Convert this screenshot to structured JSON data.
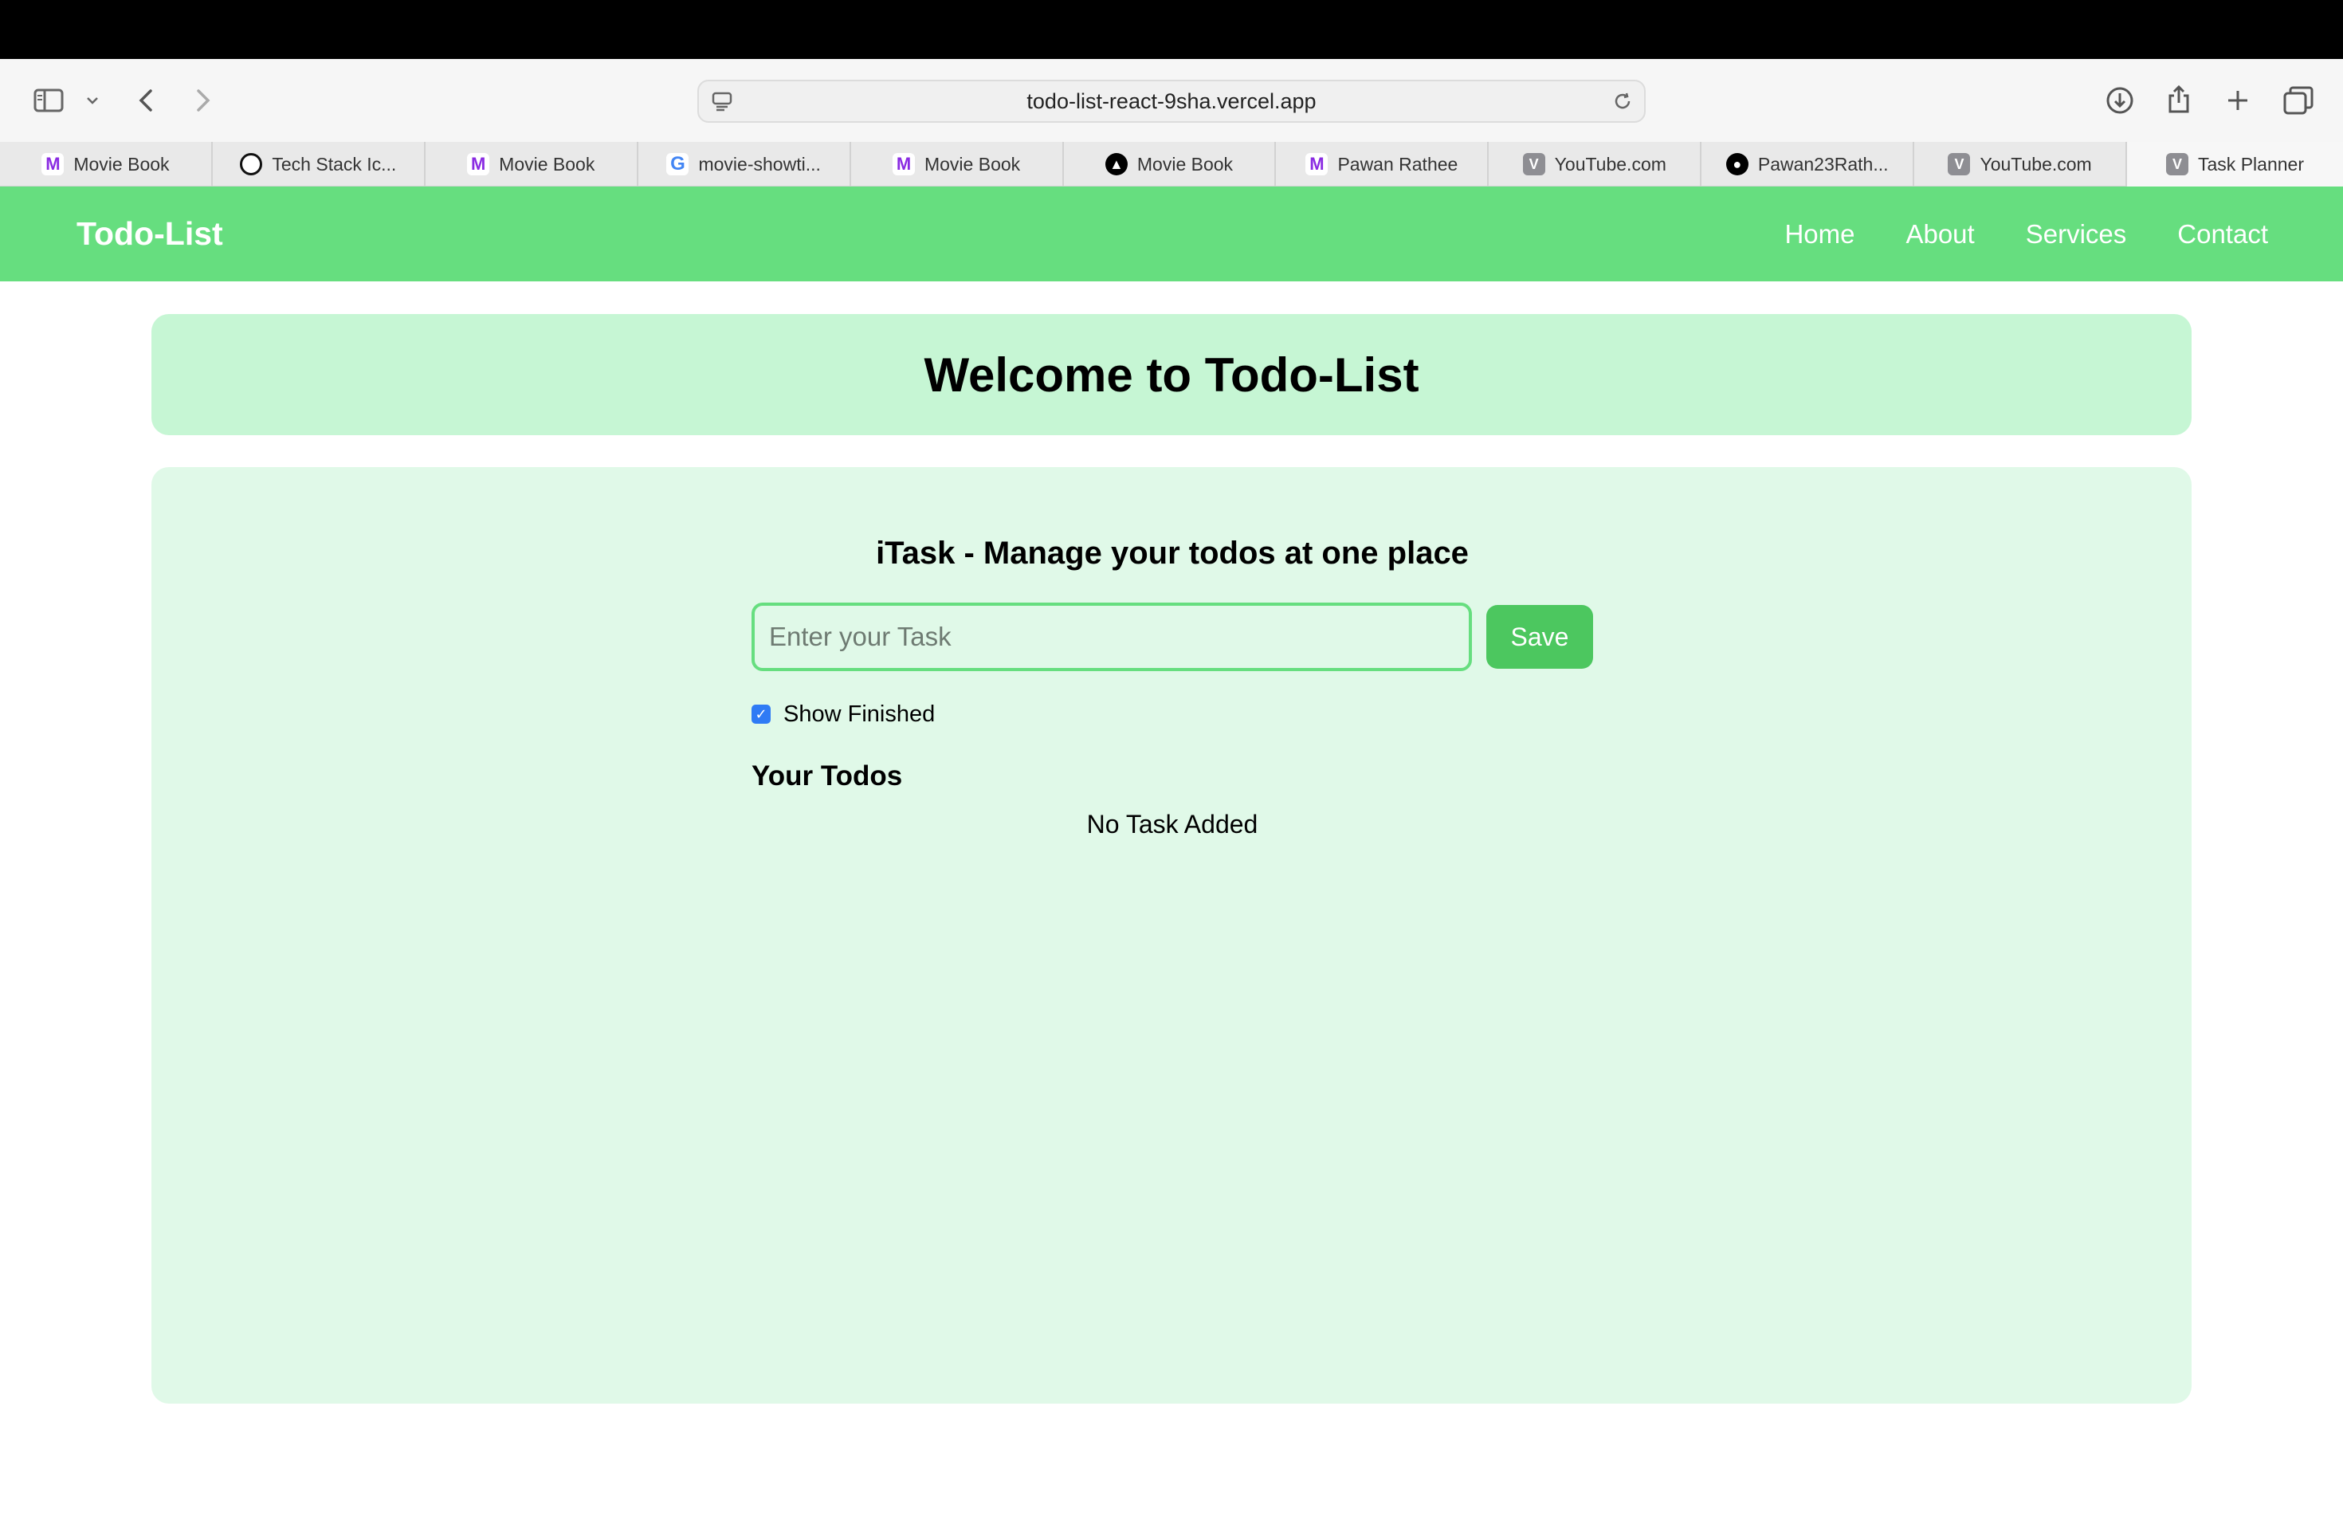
{
  "browser": {
    "url": "todo-list-react-9sha.vercel.app",
    "tabs": [
      {
        "label": "Movie Book",
        "favicon": "m"
      },
      {
        "label": "Tech Stack Ic...",
        "favicon": "tech"
      },
      {
        "label": "Movie Book",
        "favicon": "m"
      },
      {
        "label": "movie-showti...",
        "favicon": "g"
      },
      {
        "label": "Movie Book",
        "favicon": "m"
      },
      {
        "label": "Movie Book",
        "favicon": "triangle"
      },
      {
        "label": "Pawan Rathee",
        "favicon": "m"
      },
      {
        "label": "YouTube.com",
        "favicon": "v"
      },
      {
        "label": "Pawan23Rath...",
        "favicon": "github"
      },
      {
        "label": "YouTube.com",
        "favicon": "v"
      },
      {
        "label": "Task Planner",
        "favicon": "v",
        "active": true
      }
    ]
  },
  "navbar": {
    "brand": "Todo-List",
    "links": [
      "Home",
      "About",
      "Services",
      "Contact"
    ]
  },
  "hero": {
    "title": "Welcome to Todo-List"
  },
  "main": {
    "subtitle": "iTask - Manage your todos at one place",
    "input_placeholder": "Enter your Task",
    "input_value": "",
    "save_label": "Save",
    "show_finished_label": "Show Finished",
    "show_finished_checked": true,
    "todos_heading": "Your Todos",
    "empty_message": "No Task Added"
  },
  "colors": {
    "navbar": "#66de7f",
    "hero": "#c6f6d4",
    "panel": "#e0f9e8",
    "save_button": "#4cc75f",
    "checkbox": "#2f7bf5"
  }
}
